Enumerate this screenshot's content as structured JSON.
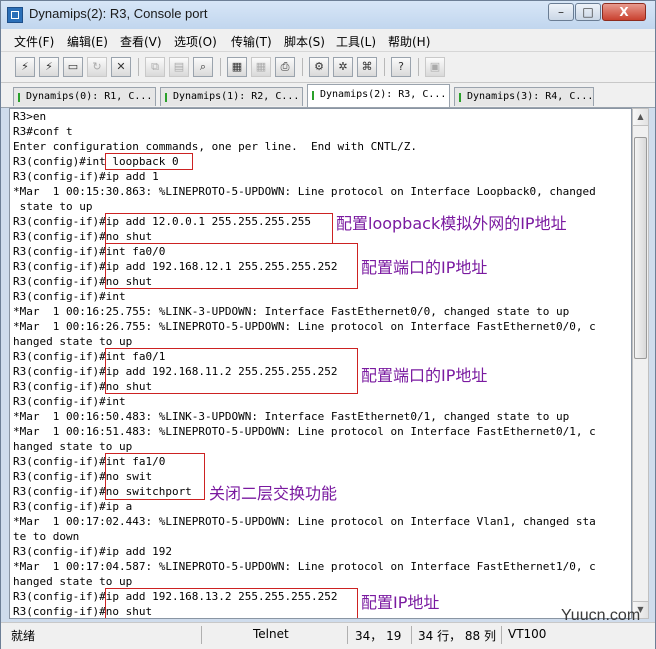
{
  "window": {
    "title": "Dynamips(2): R3, Console port",
    "controls": {
      "minimize": "–",
      "maximize": "□",
      "close": "X"
    }
  },
  "menu": [
    "文件(F)",
    "编辑(E)",
    "查看(V)",
    "选项(O)",
    "传输(T)",
    "脚本(S)",
    "工具(L)",
    "帮助(H)"
  ],
  "toolbar": {
    "icons": [
      "connect-icon",
      "quick-connect-icon",
      "connect-in-tab-icon",
      "reconnect-icon",
      "disconnect-icon",
      "copy-icon",
      "paste-icon",
      "find-icon",
      "print-setup-icon",
      "print-preview-icon",
      "print-icon",
      "session-options-icon",
      "global-options-icon",
      "keymap-icon",
      "help-icon",
      "sftp-icon"
    ]
  },
  "tabs": [
    {
      "label": "Dynamips(0): R1, C..."
    },
    {
      "label": "Dynamips(1): R2, C..."
    },
    {
      "label": "Dynamips(2): R3, C..."
    },
    {
      "label": "Dynamips(3): R4, C..."
    }
  ],
  "console": {
    "lines": [
      "R3>en",
      "R3#conf t",
      "Enter configuration commands, one per line.  End with CNTL/Z.",
      "R3(config)#int loopback 0",
      "R3(config-if)#ip add 1",
      "*Mar  1 00:15:30.863: %LINEPROTO-5-UPDOWN: Line protocol on Interface Loopback0, changed",
      " state to up",
      "R3(config-if)#ip add 12.0.0.1 255.255.255.255",
      "R3(config-if)#no shut",
      "R3(config-if)#int fa0/0",
      "R3(config-if)#ip add 192.168.12.1 255.255.255.252",
      "R3(config-if)#no shut",
      "R3(config-if)#int",
      "*Mar  1 00:16:25.755: %LINK-3-UPDOWN: Interface FastEthernet0/0, changed state to up",
      "*Mar  1 00:16:26.755: %LINEPROTO-5-UPDOWN: Line protocol on Interface FastEthernet0/0, c",
      "hanged state to up",
      "R3(config-if)#int fa0/1",
      "R3(config-if)#ip add 192.168.11.2 255.255.255.252",
      "R3(config-if)#no shut",
      "R3(config-if)#int",
      "*Mar  1 00:16:50.483: %LINK-3-UPDOWN: Interface FastEthernet0/1, changed state to up",
      "*Mar  1 00:16:51.483: %LINEPROTO-5-UPDOWN: Line protocol on Interface FastEthernet0/1, c",
      "hanged state to up",
      "R3(config-if)#int fa1/0",
      "R3(config-if)#no swit",
      "R3(config-if)#no switchport",
      "R3(config-if)#ip a",
      "*Mar  1 00:17:02.443: %LINEPROTO-5-UPDOWN: Line protocol on Interface Vlan1, changed sta",
      "te to down",
      "R3(config-if)#ip add 192",
      "*Mar  1 00:17:04.587: %LINEPROTO-5-UPDOWN: Line protocol on Interface FastEthernet1/0, c",
      "hanged state to up",
      "R3(config-if)#ip add 192.168.13.2 255.255.255.252",
      "R3(config-if)#no shut"
    ]
  },
  "annotations": [
    "配置loopback模拟外网的IP地址",
    "配置端口的IP地址",
    "配置端口的IP地址",
    "关闭二层交换功能",
    "配置IP地址"
  ],
  "statusbar": {
    "status": "就绪",
    "protocol": "Telnet",
    "cursor": "34， 19",
    "rows_cols": "34 行， 88 列",
    "terminal": "VT100"
  },
  "watermark": "Yuucn.com",
  "colors": {
    "annotation": "#7a1aa0",
    "highlight_border": "#cc2222"
  }
}
